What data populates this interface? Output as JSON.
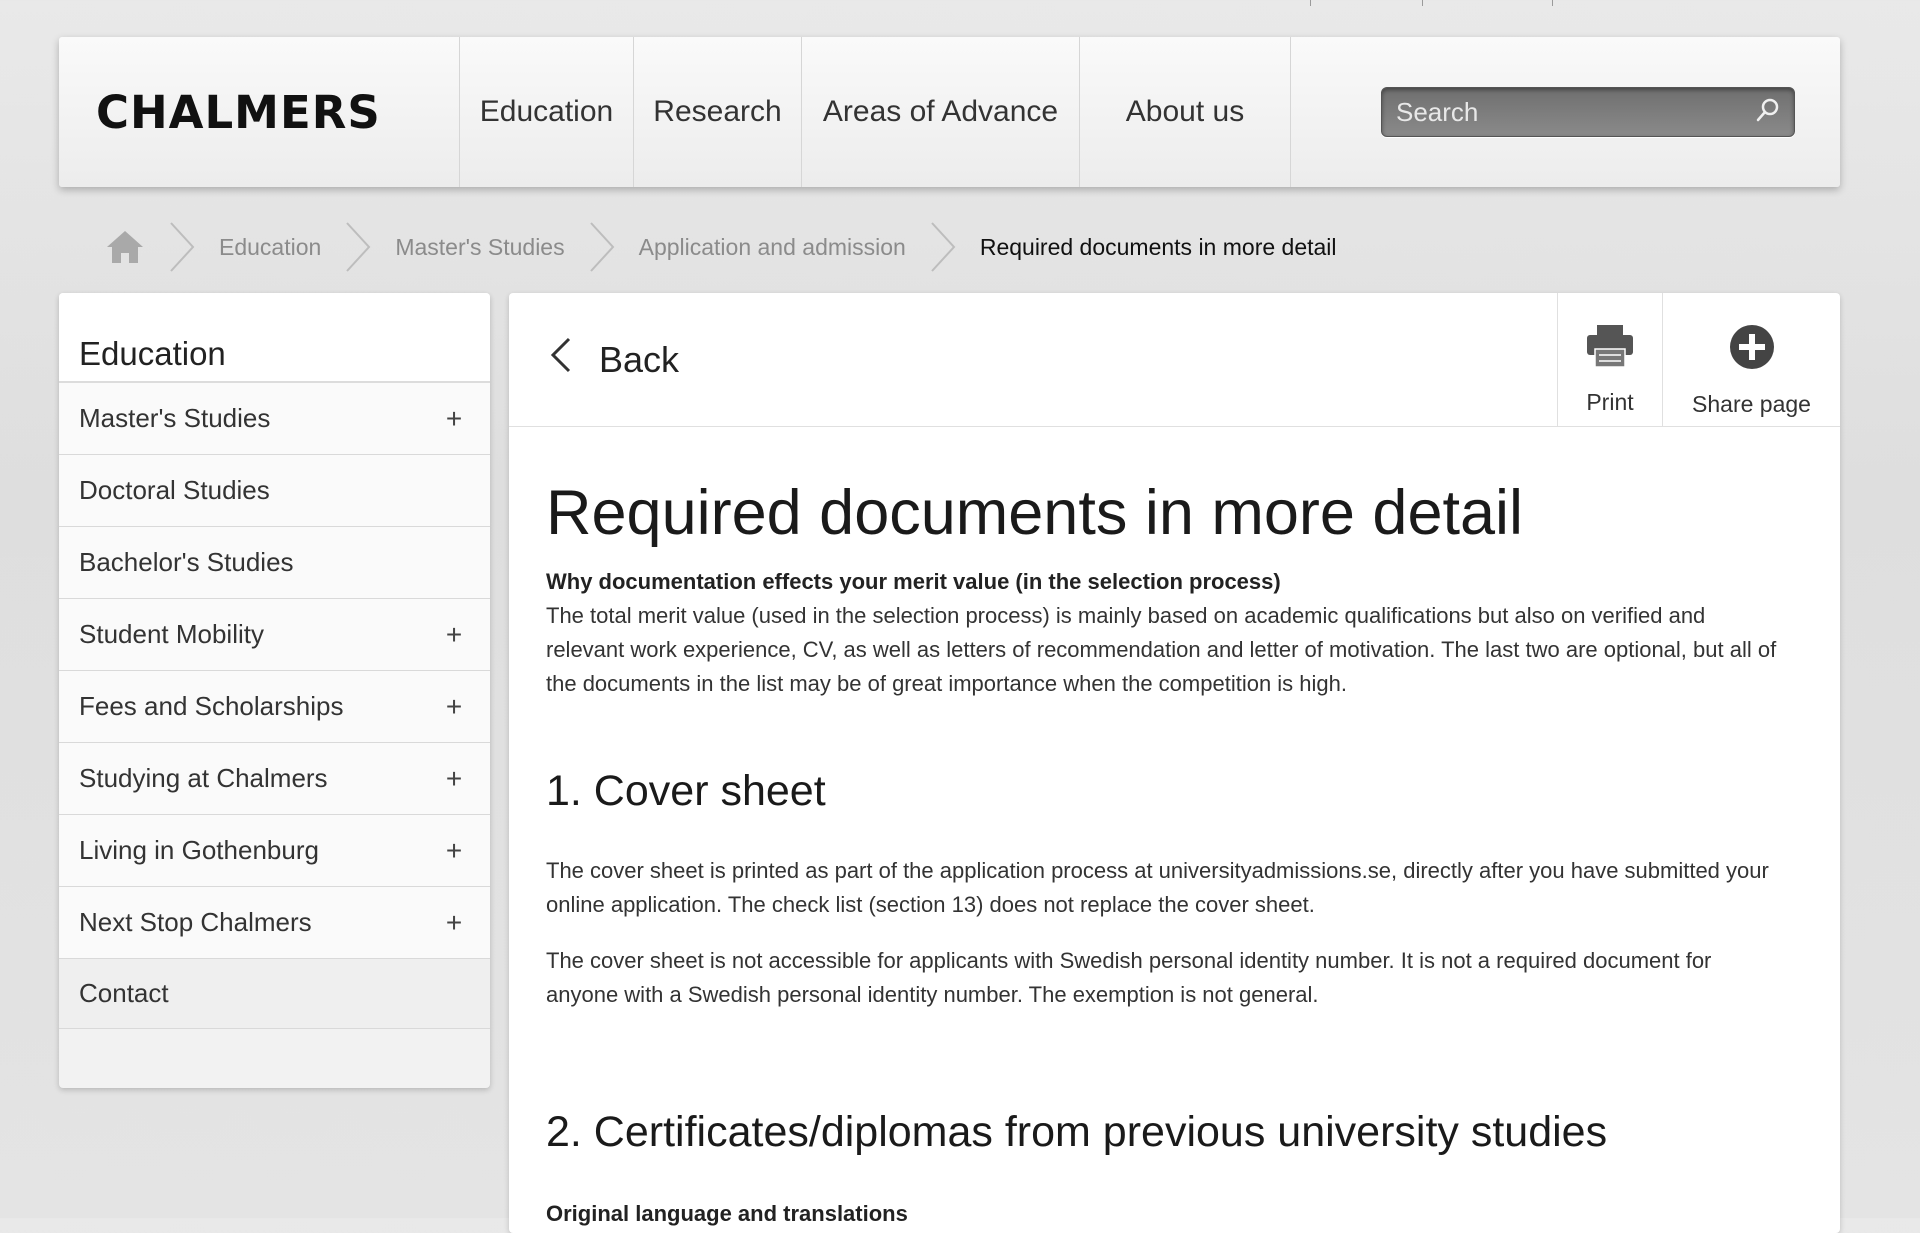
{
  "header": {
    "logo": "CHALMERS",
    "nav": [
      "Education",
      "Research",
      "Areas of Advance",
      "About us"
    ],
    "search_placeholder": "Search"
  },
  "breadcrumb": {
    "items": [
      "Education",
      "Master's Studies",
      "Application and admission"
    ],
    "current": "Required documents in more detail"
  },
  "sidebar": {
    "title": "Education",
    "items": [
      {
        "label": "Master's Studies",
        "expandable": "+"
      },
      {
        "label": "Doctoral Studies",
        "expandable": ""
      },
      {
        "label": "Bachelor's Studies",
        "expandable": ""
      },
      {
        "label": "Student Mobility",
        "expandable": "+"
      },
      {
        "label": "Fees and Scholarships",
        "expandable": "+"
      },
      {
        "label": "Studying at Chalmers",
        "expandable": "+"
      },
      {
        "label": "Living in Gothenburg",
        "expandable": "+"
      },
      {
        "label": "Next Stop Chalmers",
        "expandable": "+"
      }
    ],
    "contact": "Contact"
  },
  "toolbar": {
    "back": "Back",
    "print": "Print",
    "share": "Share page"
  },
  "content": {
    "title": "Required documents in more detail",
    "lead_heading": "Why documentation effects your merit value (in the selection process)",
    "lead_text": "The total merit value (used in the selection process) is mainly based on academic qualifications but also on verified and relevant work experience, CV, as well as letters of recommendation and letter of motivation. The last two are optional, but all of the documents in the list may be of great importance when the competition is high.",
    "section1_title": "1. Cover sheet",
    "section1_p1": "The cover sheet is printed as part of the application process at universityadmissions.se, directly after you have submitted your online application. The check list (section 13) does not replace the cover sheet.",
    "section1_p2": "The cover sheet is not accessible for applicants with Swedish personal identity number. It is not a required document for anyone with a Swedish personal identity number. The exemption is not general.",
    "section2_title": "2. Certificates/diplomas from previous university studies",
    "section2_subheading": "Original language and translations"
  }
}
